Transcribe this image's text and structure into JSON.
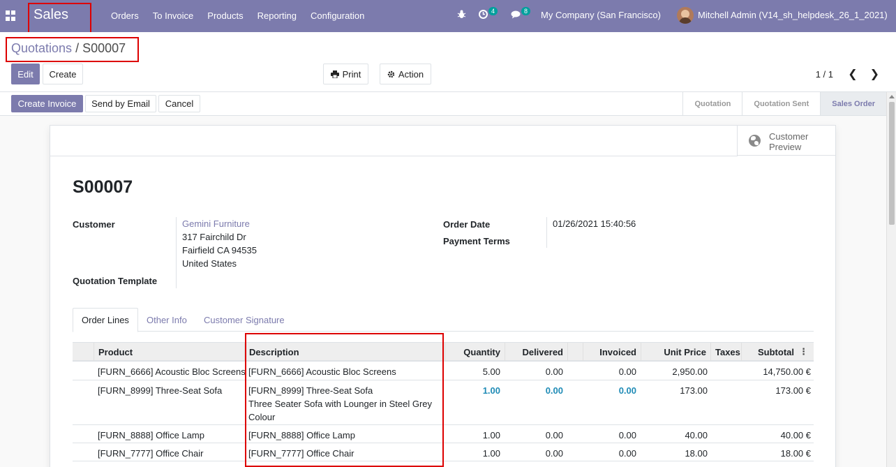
{
  "navbar": {
    "apps_icon": "apps-grid-icon",
    "brand": "Sales",
    "menu": [
      "Orders",
      "To Invoice",
      "Products",
      "Reporting",
      "Configuration"
    ],
    "activity_count": "4",
    "message_count": "8",
    "company": "My Company (San Francisco)",
    "user": "Mitchell Admin (V14_sh_helpdesk_26_1_2021)"
  },
  "control": {
    "breadcrumb_parent": "Quotations",
    "breadcrumb_sep": " / ",
    "breadcrumb_current": "S00007",
    "edit_label": "Edit",
    "create_label": "Create",
    "print_label": "Print",
    "action_label": "Action",
    "pager": "1 / 1"
  },
  "statusbar": {
    "create_invoice": "Create Invoice",
    "send_email": "Send by Email",
    "cancel": "Cancel",
    "stages": [
      "Quotation",
      "Quotation Sent",
      "Sales Order"
    ],
    "active_stage": "Sales Order"
  },
  "sheet": {
    "customer_preview_line1": "Customer",
    "customer_preview_line2": "Preview",
    "title": "S00007",
    "customer_label": "Customer",
    "customer_name": "Gemini Furniture",
    "address1": "317 Fairchild Dr",
    "address2": "Fairfield CA 94535",
    "address3": "United States",
    "template_label": "Quotation Template",
    "order_date_label": "Order Date",
    "order_date": "01/26/2021 15:40:56",
    "payment_terms_label": "Payment Terms"
  },
  "tabs": [
    "Order Lines",
    "Other Info",
    "Customer Signature"
  ],
  "table": {
    "headers": {
      "product": "Product",
      "description": "Description",
      "quantity": "Quantity",
      "delivered": "Delivered",
      "invoiced": "Invoiced",
      "unit_price": "Unit Price",
      "taxes": "Taxes",
      "subtotal": "Subtotal"
    },
    "rows": [
      {
        "product": "[FURN_6666] Acoustic Bloc Screens",
        "description": "[FURN_6666] Acoustic Bloc Screens",
        "description2": "",
        "description3": "",
        "quantity": "5.00",
        "delivered": "0.00",
        "invoiced": "0.00",
        "unit_price": "2,950.00",
        "subtotal": "14,750.00 €"
      },
      {
        "product": "[FURN_8999] Three-Seat Sofa",
        "description": "[FURN_8999] Three-Seat Sofa",
        "description2": "Three Seater Sofa with Lounger in Steel Grey",
        "description3": "Colour",
        "quantity": "1.00",
        "delivered": "0.00",
        "invoiced": "0.00",
        "unit_price": "173.00",
        "subtotal": "173.00 €"
      },
      {
        "product": "[FURN_8888] Office Lamp",
        "description": "[FURN_8888] Office Lamp",
        "description2": "",
        "description3": "",
        "quantity": "1.00",
        "delivered": "0.00",
        "invoiced": "0.00",
        "unit_price": "40.00",
        "subtotal": "40.00 €"
      },
      {
        "product": "[FURN_7777] Office Chair",
        "description": "[FURN_7777] Office Chair",
        "description2": "",
        "description3": "",
        "quantity": "1.00",
        "delivered": "0.00",
        "invoiced": "0.00",
        "unit_price": "18.00",
        "subtotal": "18.00 €"
      }
    ]
  },
  "colors": {
    "brand": "#7c7bad",
    "highlight_number": "#1f8bb6",
    "annotation_box": "#dd0000"
  }
}
